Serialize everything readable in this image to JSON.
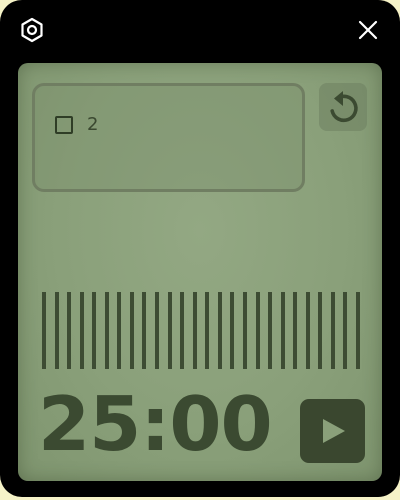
{
  "titlebar": {
    "settings_icon": "hexagon-gear-icon",
    "close_icon": "close-icon"
  },
  "task": {
    "checked": false,
    "label": "2"
  },
  "timer": {
    "display": "25:00",
    "remaining_fraction": 1.0,
    "tick_count": 26
  },
  "controls": {
    "reset_icon": "reset-icon",
    "play_icon": "play-icon"
  },
  "colors": {
    "window": "#000000",
    "lcd": "#8aa07a",
    "ink": "#3b4a31",
    "play_button": "#3a472f"
  }
}
